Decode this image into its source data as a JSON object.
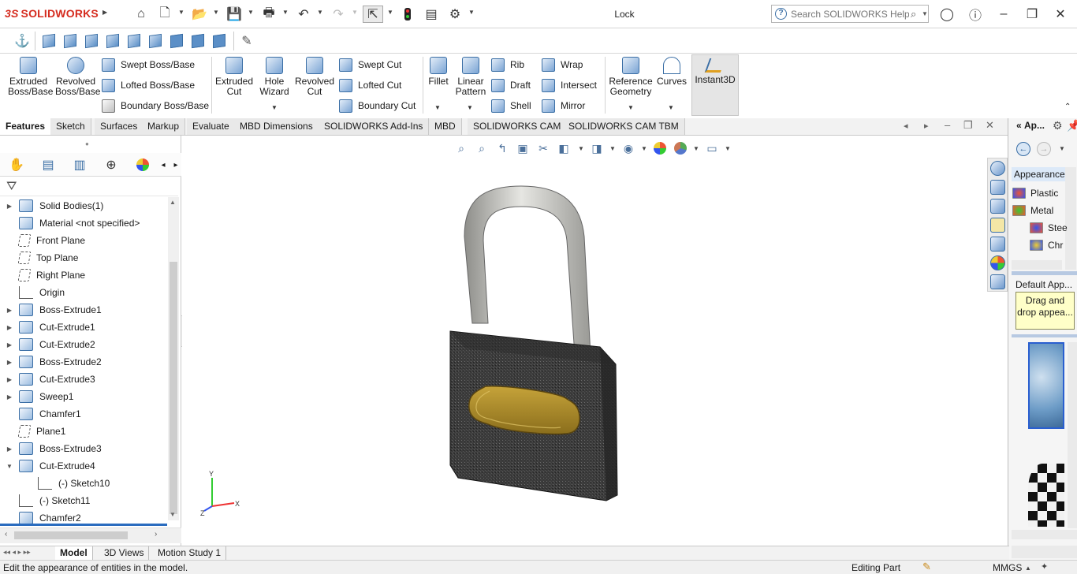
{
  "app": {
    "brand": "SOLIDWORKS",
    "window_title": "Lock",
    "search_placeholder": "Search SOLIDWORKS Help"
  },
  "command_manager": {
    "extruded_boss": "Extruded\nBoss/Base",
    "revolved_boss": "Revolved\nBoss/Base",
    "swept_boss": "Swept Boss/Base",
    "lofted_boss": "Lofted Boss/Base",
    "boundary_boss": "Boundary Boss/Base",
    "extruded_cut": "Extruded\nCut",
    "hole_wizard": "Hole\nWizard",
    "revolved_cut": "Revolved\nCut",
    "swept_cut": "Swept Cut",
    "lofted_cut": "Lofted Cut",
    "boundary_cut": "Boundary Cut",
    "fillet": "Fillet",
    "linear_pattern": "Linear\nPattern",
    "rib": "Rib",
    "draft": "Draft",
    "shell": "Shell",
    "wrap": "Wrap",
    "intersect": "Intersect",
    "mirror": "Mirror",
    "reference_geometry": "Reference\nGeometry",
    "curves": "Curves",
    "instant3d": "Instant3D"
  },
  "tabs": [
    "Features",
    "Sketch",
    "Surfaces",
    "Markup",
    "Evaluate",
    "MBD Dimensions",
    "SOLIDWORKS Add-Ins",
    "MBD",
    "SOLIDWORKS CAM",
    "SOLIDWORKS CAM TBM"
  ],
  "tree": [
    {
      "label": "Solid Bodies(1)",
      "expander": "▶",
      "icon": "solid-bodies-icon"
    },
    {
      "label": "Material <not specified>",
      "expander": "",
      "icon": "material-icon"
    },
    {
      "label": "Front Plane",
      "expander": "",
      "icon": "plane-icon"
    },
    {
      "label": "Top Plane",
      "expander": "",
      "icon": "plane-icon"
    },
    {
      "label": "Right Plane",
      "expander": "",
      "icon": "plane-icon"
    },
    {
      "label": "Origin",
      "expander": "",
      "icon": "origin-icon"
    },
    {
      "label": "Boss-Extrude1",
      "expander": "▶",
      "icon": "boss-extrude-icon"
    },
    {
      "label": "Cut-Extrude1",
      "expander": "▶",
      "icon": "cut-extrude-icon"
    },
    {
      "label": "Cut-Extrude2",
      "expander": "▶",
      "icon": "cut-extrude-icon"
    },
    {
      "label": "Boss-Extrude2",
      "expander": "▶",
      "icon": "boss-extrude-icon"
    },
    {
      "label": "Cut-Extrude3",
      "expander": "▶",
      "icon": "cut-extrude-icon"
    },
    {
      "label": "Sweep1",
      "expander": "▶",
      "icon": "sweep-icon"
    },
    {
      "label": "Chamfer1",
      "expander": "",
      "icon": "chamfer-icon"
    },
    {
      "label": "Plane1",
      "expander": "",
      "icon": "plane-icon"
    },
    {
      "label": "Boss-Extrude3",
      "expander": "▶",
      "icon": "boss-extrude-icon"
    },
    {
      "label": "Cut-Extrude4",
      "expander": "▼",
      "icon": "cut-extrude-icon"
    },
    {
      "label": "(-) Sketch10",
      "expander": "",
      "icon": "sketch-icon",
      "indent": true
    },
    {
      "label": "(-) Sketch11",
      "expander": "",
      "icon": "sketch-icon"
    },
    {
      "label": "Chamfer2",
      "expander": "",
      "icon": "chamfer-icon"
    }
  ],
  "bottom_tabs": [
    "Model",
    "3D Views",
    "Motion Study 1"
  ],
  "status": {
    "message": "Edit the appearance of entities in the model.",
    "mode": "Editing Part",
    "units": "MMGS"
  },
  "task_pane": {
    "title": "Ap...",
    "header": "Appearances",
    "items": [
      "Plastic",
      "Metal",
      "Stee",
      "Chr"
    ],
    "default_label": "Default App...",
    "drag_hint": "Drag and drop appea..."
  },
  "colors": {
    "brand_red": "#d52b1e",
    "accent_blue": "#3a6ea5",
    "lock_body": "#3a3a3a",
    "nameplate": "#a8892a",
    "shackle": "#c9c9c6"
  }
}
